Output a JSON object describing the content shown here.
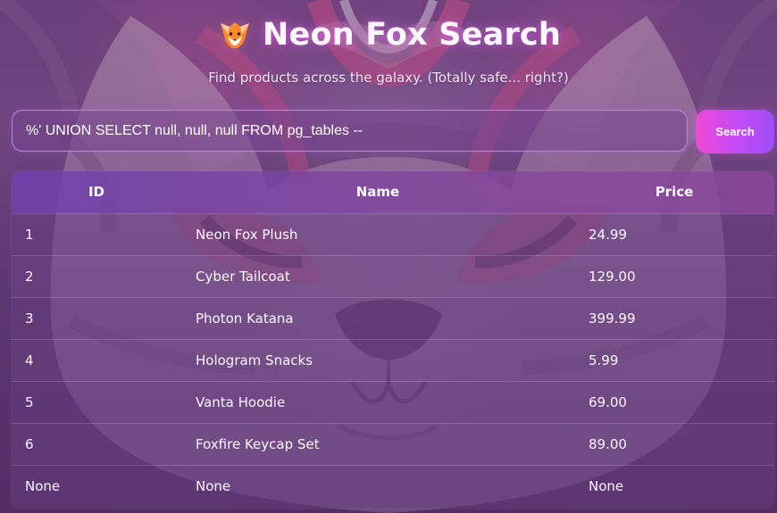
{
  "header": {
    "icon": "fox-icon",
    "title": "Neon Fox Search",
    "subtitle": "Find products across the galaxy. (Totally safe... right?)"
  },
  "search": {
    "value": "%' UNION SELECT null, null, null FROM pg_tables --",
    "button_label": "Search"
  },
  "table": {
    "columns": [
      "ID",
      "Name",
      "Price"
    ],
    "rows": [
      {
        "id": "1",
        "name": "Neon Fox Plush",
        "price": "24.99"
      },
      {
        "id": "2",
        "name": "Cyber Tailcoat",
        "price": "129.00"
      },
      {
        "id": "3",
        "name": "Photon Katana",
        "price": "399.99"
      },
      {
        "id": "4",
        "name": "Hologram Snacks",
        "price": "5.99"
      },
      {
        "id": "5",
        "name": "Vanta Hoodie",
        "price": "69.00"
      },
      {
        "id": "6",
        "name": "Foxfire Keycap Set",
        "price": "89.00"
      },
      {
        "id": "None",
        "name": "None",
        "price": "None"
      }
    ]
  },
  "colors": {
    "accent": "#ef4ad6",
    "accent_2": "#9b4df7",
    "background": "#6c4a81"
  }
}
